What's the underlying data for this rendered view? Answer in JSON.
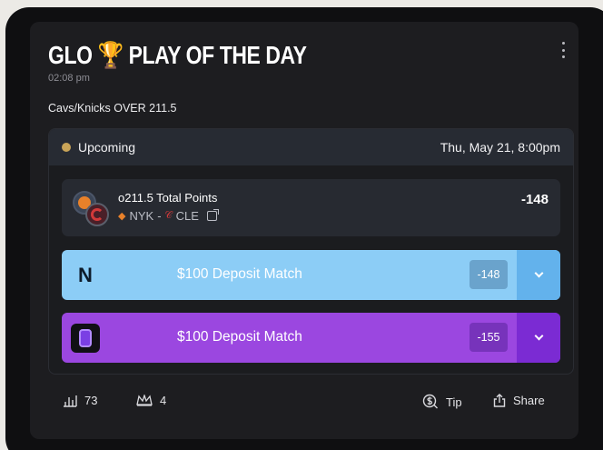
{
  "post": {
    "title": "GLO 🏆 PLAY OF THE DAY",
    "time": "02:08 pm",
    "caption": "Cavs/Knicks OVER 211.5"
  },
  "event": {
    "status": "Upcoming",
    "date": "Thu, May 21, 8:00pm",
    "bet": {
      "title": "o211.5 Total Points",
      "away": "NYK",
      "separator": "-",
      "home": "CLE",
      "odds": "-148"
    },
    "books": [
      {
        "promo": "$100 Deposit Match",
        "odds": "-148",
        "color": "#8ccdf6"
      },
      {
        "promo": "$100 Deposit Match",
        "odds": "-155",
        "color": "#9b47e0"
      }
    ]
  },
  "footer": {
    "stats_count": "73",
    "crown_count": "4",
    "tip_label": "Tip",
    "share_label": "Share"
  },
  "icons": [
    "more-vertical-icon",
    "bar-chart-icon",
    "crown-icon",
    "dollar-coin-icon",
    "share-icon",
    "chevron-down-icon",
    "external-link-icon"
  ]
}
